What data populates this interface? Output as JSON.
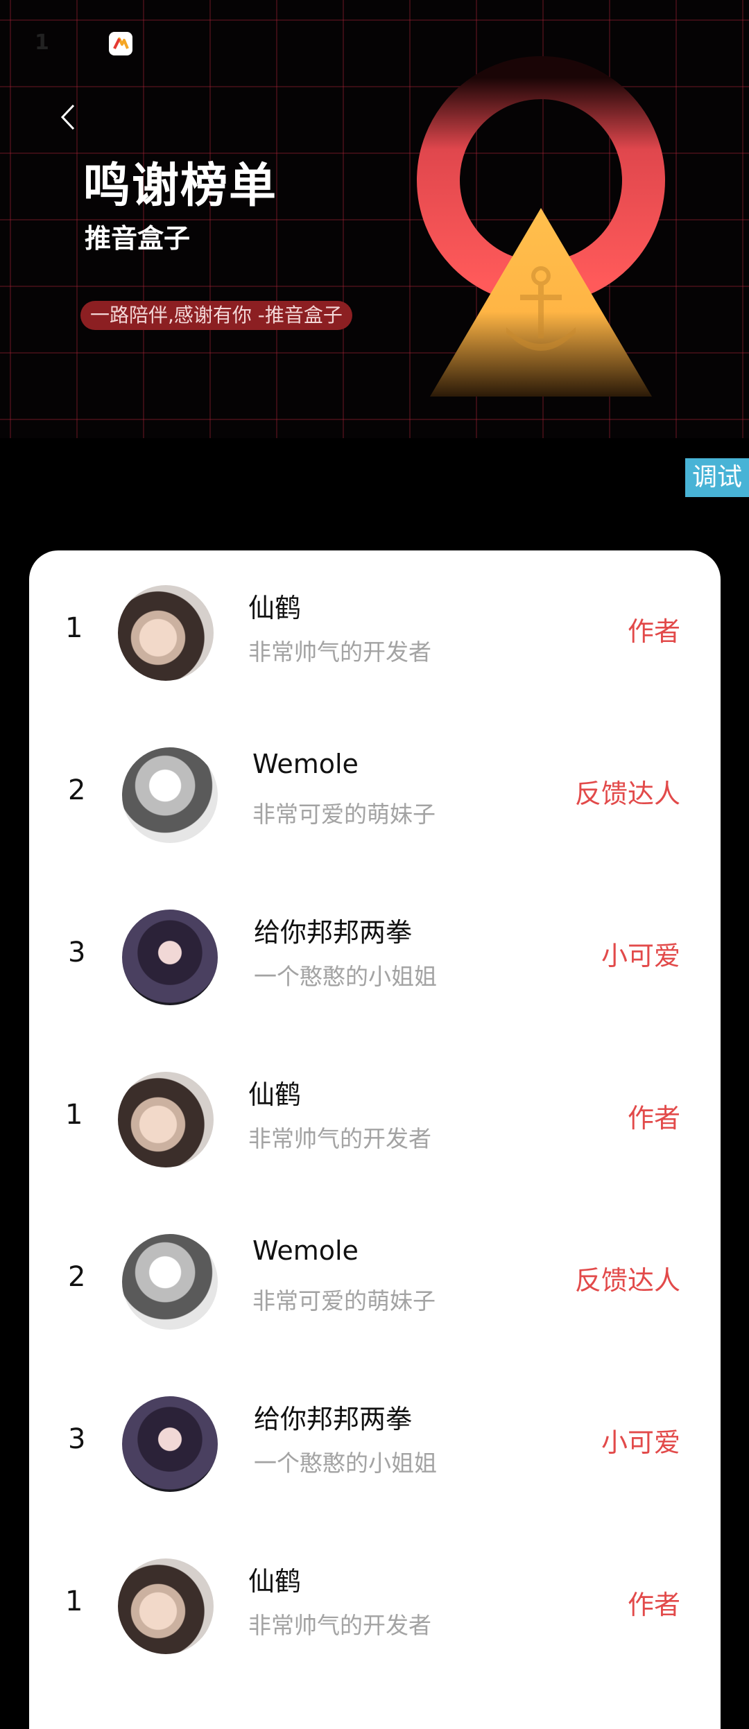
{
  "status_bar": {
    "time": "1"
  },
  "header": {
    "title": "鸣谢榜单",
    "subtitle": "推音盒子",
    "slogan": "一路陪伴,感谢有你 -推音盒子"
  },
  "debug_label": "调试",
  "colors": {
    "accent_red": "#e24a4a",
    "debug_blue": "#48b3d6",
    "slogan_bg": "#8c1f22"
  },
  "list": [
    {
      "rank": "1",
      "name": "仙鹤",
      "desc": "非常帅气的开发者",
      "tag": "作者",
      "avatar": "a1"
    },
    {
      "rank": "2",
      "name": "Wemole",
      "desc": "非常可爱的萌妹子",
      "tag": "反馈达人",
      "avatar": "a2"
    },
    {
      "rank": "3",
      "name": "给你邦邦两拳",
      "desc": "一个憨憨的小姐姐",
      "tag": "小可爱",
      "avatar": "a3"
    },
    {
      "rank": "1",
      "name": "仙鹤",
      "desc": "非常帅气的开发者",
      "tag": "作者",
      "avatar": "a1"
    },
    {
      "rank": "2",
      "name": "Wemole",
      "desc": "非常可爱的萌妹子",
      "tag": "反馈达人",
      "avatar": "a2"
    },
    {
      "rank": "3",
      "name": "给你邦邦两拳",
      "desc": "一个憨憨的小姐姐",
      "tag": "小可爱",
      "avatar": "a3"
    },
    {
      "rank": "1",
      "name": "仙鹤",
      "desc": "非常帅气的开发者",
      "tag": "作者",
      "avatar": "a1"
    }
  ]
}
